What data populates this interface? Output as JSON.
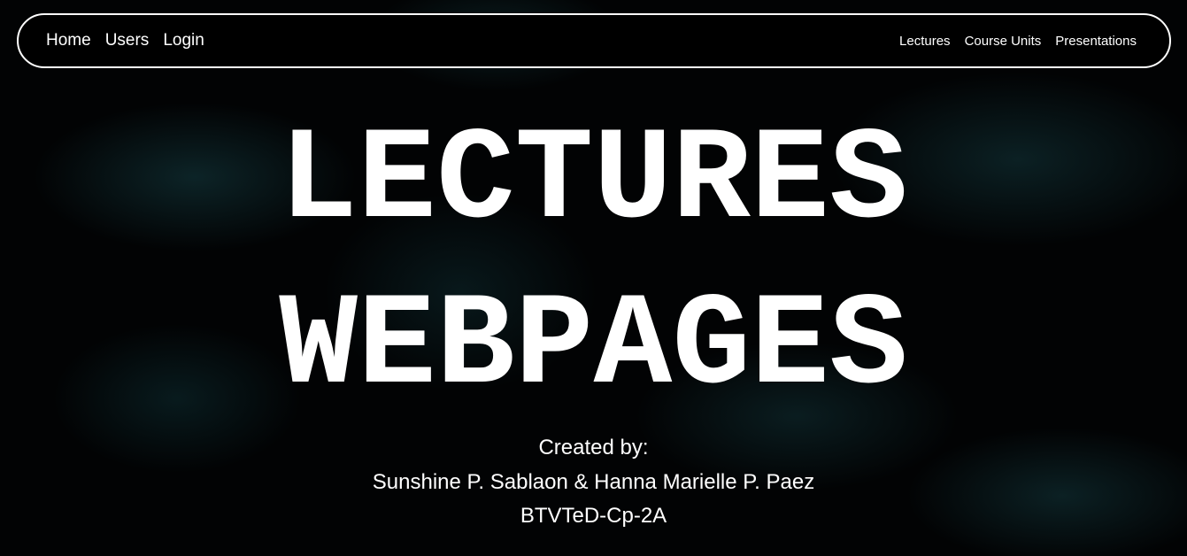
{
  "nav": {
    "left_links": [
      "Home",
      "Users",
      "Login"
    ],
    "right_links": [
      "Lectures",
      "Course Units",
      "Presentations"
    ]
  },
  "hero": {
    "title_line1": "LECTURES",
    "title_line2": "WEBPAGES",
    "created_by_label": "Created by:",
    "authors": "Sunshine P. Sablaon & Hanna Marielle P. Paez",
    "section": "BTVTeD-Cp-2A"
  },
  "colors": {
    "background": "#020304",
    "accent": "#2a8a94",
    "text": "#ffffff"
  }
}
